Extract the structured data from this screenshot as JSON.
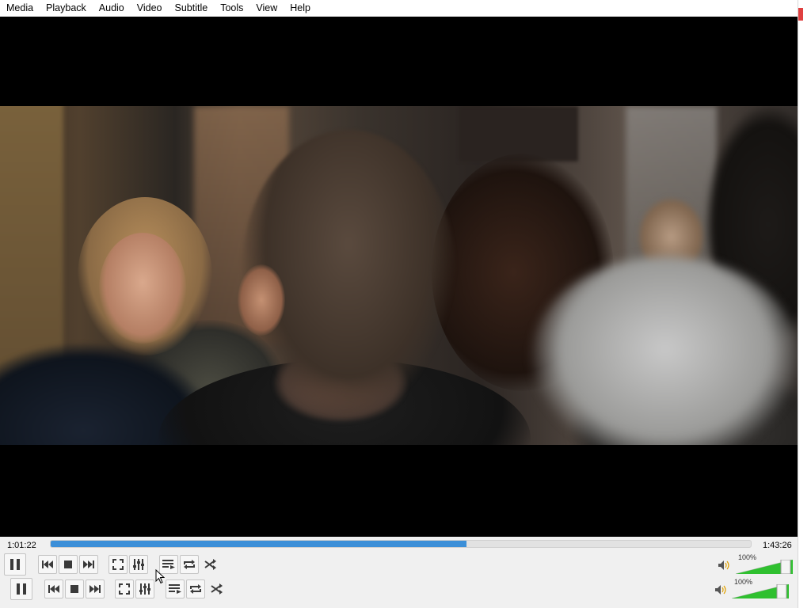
{
  "menu": [
    "Media",
    "Playback",
    "Audio",
    "Video",
    "Subtitle",
    "Tools",
    "View",
    "Help"
  ],
  "player": {
    "time_elapsed": "1:01:22",
    "time_total": "1:43:26",
    "progress": 0.594
  },
  "controls": {
    "row1": {
      "volume_label": "100%",
      "volume_level": 1.0
    },
    "row2": {
      "volume_label": "100%",
      "volume_level": 1.0
    }
  },
  "colors": {
    "accent": "#3c8fd8",
    "volume_green": "#2fc02f",
    "icon": "#3a3a3a"
  },
  "icons": [
    "pause-icon",
    "previous-icon",
    "stop-icon",
    "next-icon",
    "fullscreen-icon",
    "extended-settings-icon",
    "playlist-icon",
    "loop-icon",
    "shuffle-icon",
    "speaker-icon",
    "cursor-icon"
  ]
}
